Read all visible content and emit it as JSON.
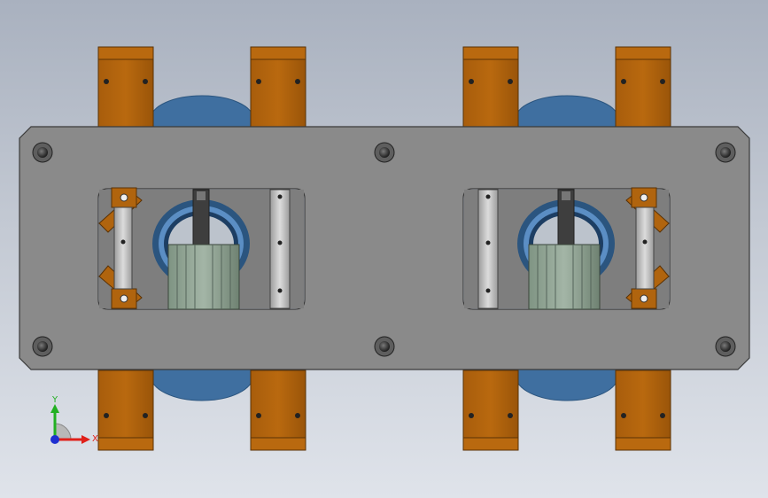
{
  "viewport": {
    "background_top": "#a9b1bf",
    "background_bottom": "#dfe3ea"
  },
  "colors": {
    "plate": "#8a8a8a",
    "plate_edge": "#3a3a3a",
    "bracket": "#b0640e",
    "bracket_dark": "#8a4c08",
    "disc": "#3f6fa0",
    "disc_dark": "#2b557f",
    "rail": "#c9c9c9",
    "motor": "#8fa393",
    "motor_dark": "#6d7f70",
    "shaft": "#4a4a4a"
  },
  "triad": {
    "x_label": "X",
    "y_label": "Y",
    "x_color": "#e0201a",
    "y_color": "#22b022",
    "z_color": "#1e2fd0"
  }
}
